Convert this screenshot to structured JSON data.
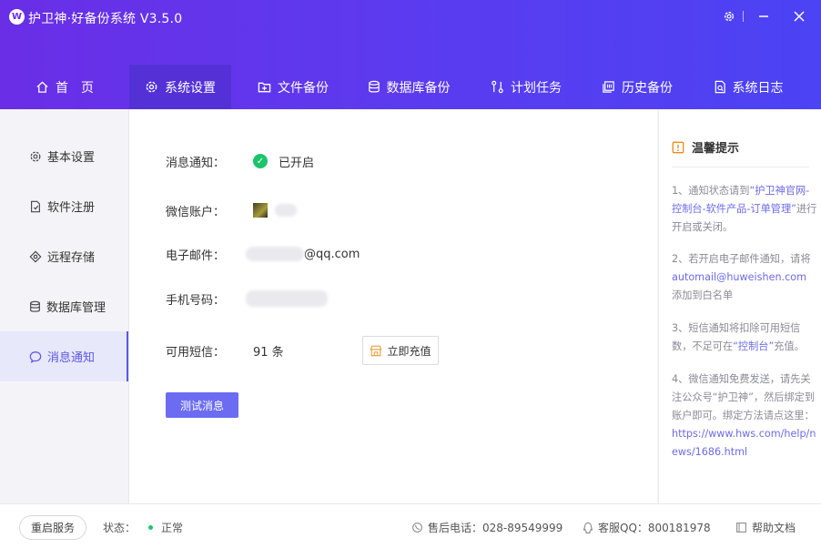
{
  "app": {
    "title": "护卫神·好备份系统 V3.5.0",
    "logo_letter": "W"
  },
  "nav": [
    {
      "label": "首　页",
      "icon": "home-icon"
    },
    {
      "label": "系统设置",
      "icon": "gear-icon",
      "active": true
    },
    {
      "label": "文件备份",
      "icon": "folder-plus-icon"
    },
    {
      "label": "数据库备份",
      "icon": "database-icon"
    },
    {
      "label": "计划任务",
      "icon": "schedule-icon"
    },
    {
      "label": "历史备份",
      "icon": "history-icon"
    },
    {
      "label": "系统日志",
      "icon": "log-icon"
    }
  ],
  "sidebar": [
    {
      "label": "基本设置",
      "icon": "gear-icon"
    },
    {
      "label": "软件注册",
      "icon": "register-icon"
    },
    {
      "label": "远程存储",
      "icon": "remote-storage-icon"
    },
    {
      "label": "数据库管理",
      "icon": "database-icon"
    },
    {
      "label": "消息通知",
      "icon": "message-icon",
      "active": true
    }
  ],
  "main": {
    "notify_label": "消息通知：",
    "notify_status": "已开启",
    "wechat_label": "微信账户：",
    "email_label": "电子邮件：",
    "email_value": "@qq.com",
    "phone_label": "手机号码：",
    "sms_label": "可用短信：",
    "sms_count": "91 条",
    "recharge_label": "立即充值",
    "test_button": "测试消息"
  },
  "tips": {
    "title": "温馨提示",
    "tip1_a": "1、通知状态请到",
    "tip1_hl": "“护卫神官网-控制台-软件产品-订单管理”",
    "tip1_b": "进行开启或关闭。",
    "tip2_a": "2、若开启电子邮件通知，请将",
    "tip2_hl": "automail@huweishen.com",
    "tip2_b": "添加到白名单",
    "tip3_a": "3、短信通知将扣除可用短信数，不足可在",
    "tip3_hl": "“控制台”",
    "tip3_b": "充值。",
    "tip4_a": "4、微信通知免费发送，请先关注公众号“护卫神”，然后绑定到账户即可。绑定方法请点这里：",
    "tip4_hl": "https://www.hws.com/help/news/1686.html"
  },
  "footer": {
    "restart": "重启服务",
    "status_label": "状态：",
    "status_value": "正常",
    "phone": "售后电话：028-89549999",
    "qq": "客服QQ：800181978",
    "help": "帮助文档"
  },
  "colors": {
    "accent": "#5b57e6",
    "header_start": "#6a2ee6",
    "header_end": "#4b43f4",
    "success": "#1cc46b"
  }
}
